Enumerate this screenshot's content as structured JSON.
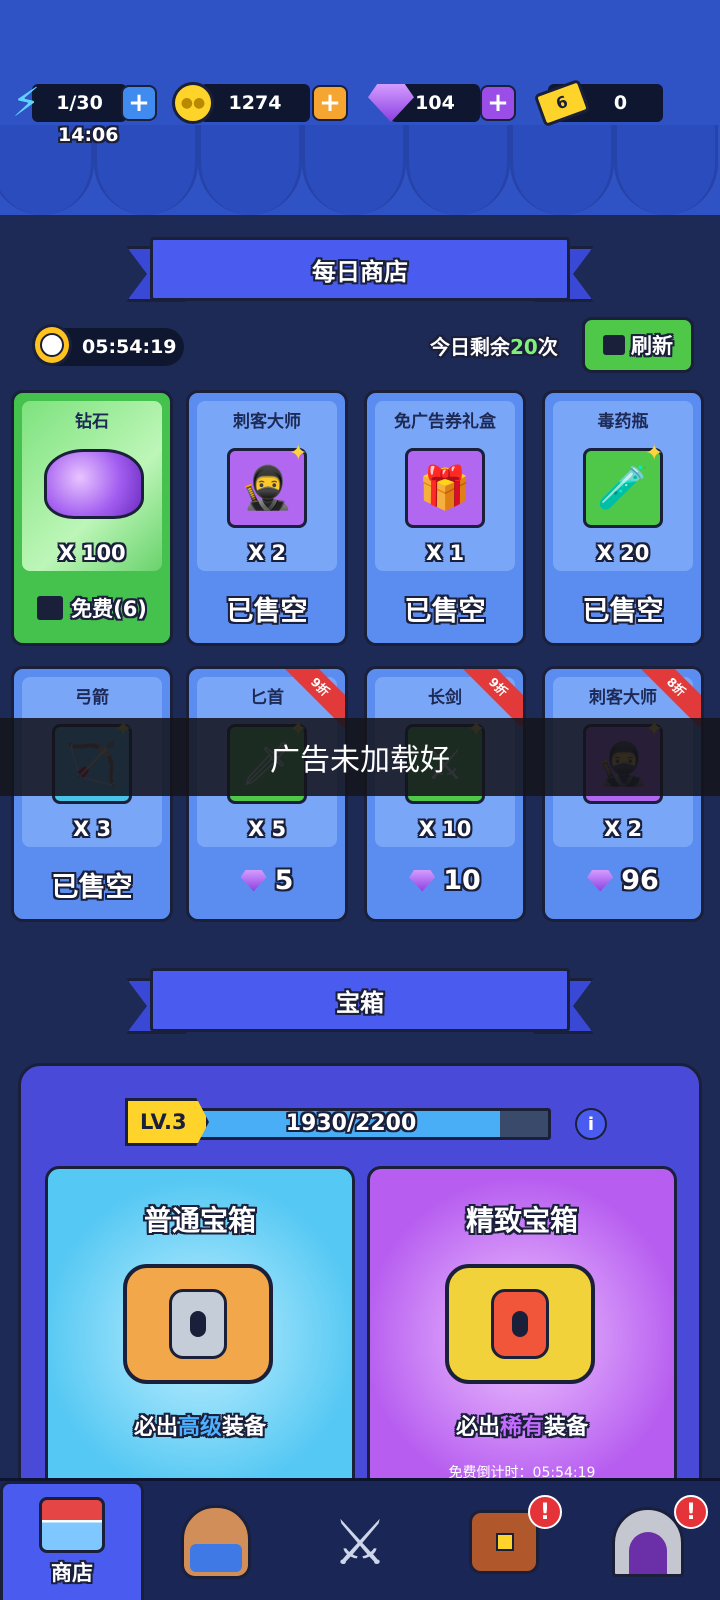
{
  "currency": {
    "energy": "1/30",
    "energy_timer": "14:06",
    "coins": "1274",
    "gems": "104",
    "tickets": "0"
  },
  "daily_shop": {
    "title": "每日商店",
    "timer": "05:54:19",
    "remaining_prefix": "今日剩余",
    "remaining_count": "20",
    "remaining_suffix": "次",
    "refresh_label": "刷新",
    "items": [
      {
        "name": "钻石",
        "qty": "X 100",
        "bottom": "免费(6)"
      },
      {
        "name": "刺客大师",
        "qty": "X 2",
        "bottom": "已售空"
      },
      {
        "name": "免广告券礼盒",
        "qty": "X 1",
        "bottom": "已售空"
      },
      {
        "name": "毒药瓶",
        "qty": "X 20",
        "bottom": "已售空"
      },
      {
        "name": "弓箭",
        "qty": "X 3",
        "bottom": "已售空"
      },
      {
        "name": "匕首",
        "qty": "X 5",
        "bottom": "5",
        "discount": "9折"
      },
      {
        "name": "长剑",
        "qty": "X 10",
        "bottom": "10",
        "discount": "9折"
      },
      {
        "name": "刺客大师",
        "qty": "X 2",
        "bottom": "96",
        "discount": "8折"
      }
    ]
  },
  "toast": "广告未加载好",
  "chest": {
    "title": "宝箱",
    "level": "LV.3",
    "progress_text": "1930/2200",
    "progress": 0.877,
    "normal": {
      "title": "普通宝箱",
      "sub_prefix": "必出",
      "sub_highlight": "高级",
      "sub_suffix": "装备"
    },
    "fine": {
      "title": "精致宝箱",
      "sub_prefix": "必出",
      "sub_highlight": "稀有",
      "sub_suffix": "装备",
      "free_timer": "免费倒计时：05:54:19"
    }
  },
  "nav": {
    "shop_label": "商店"
  },
  "colors": {
    "accent_blue": "#4a5cf0",
    "card_blue": "#5b8df0",
    "green": "#45c24d",
    "highlight_blue": "#4fb0ff",
    "highlight_purple": "#c36cff"
  }
}
